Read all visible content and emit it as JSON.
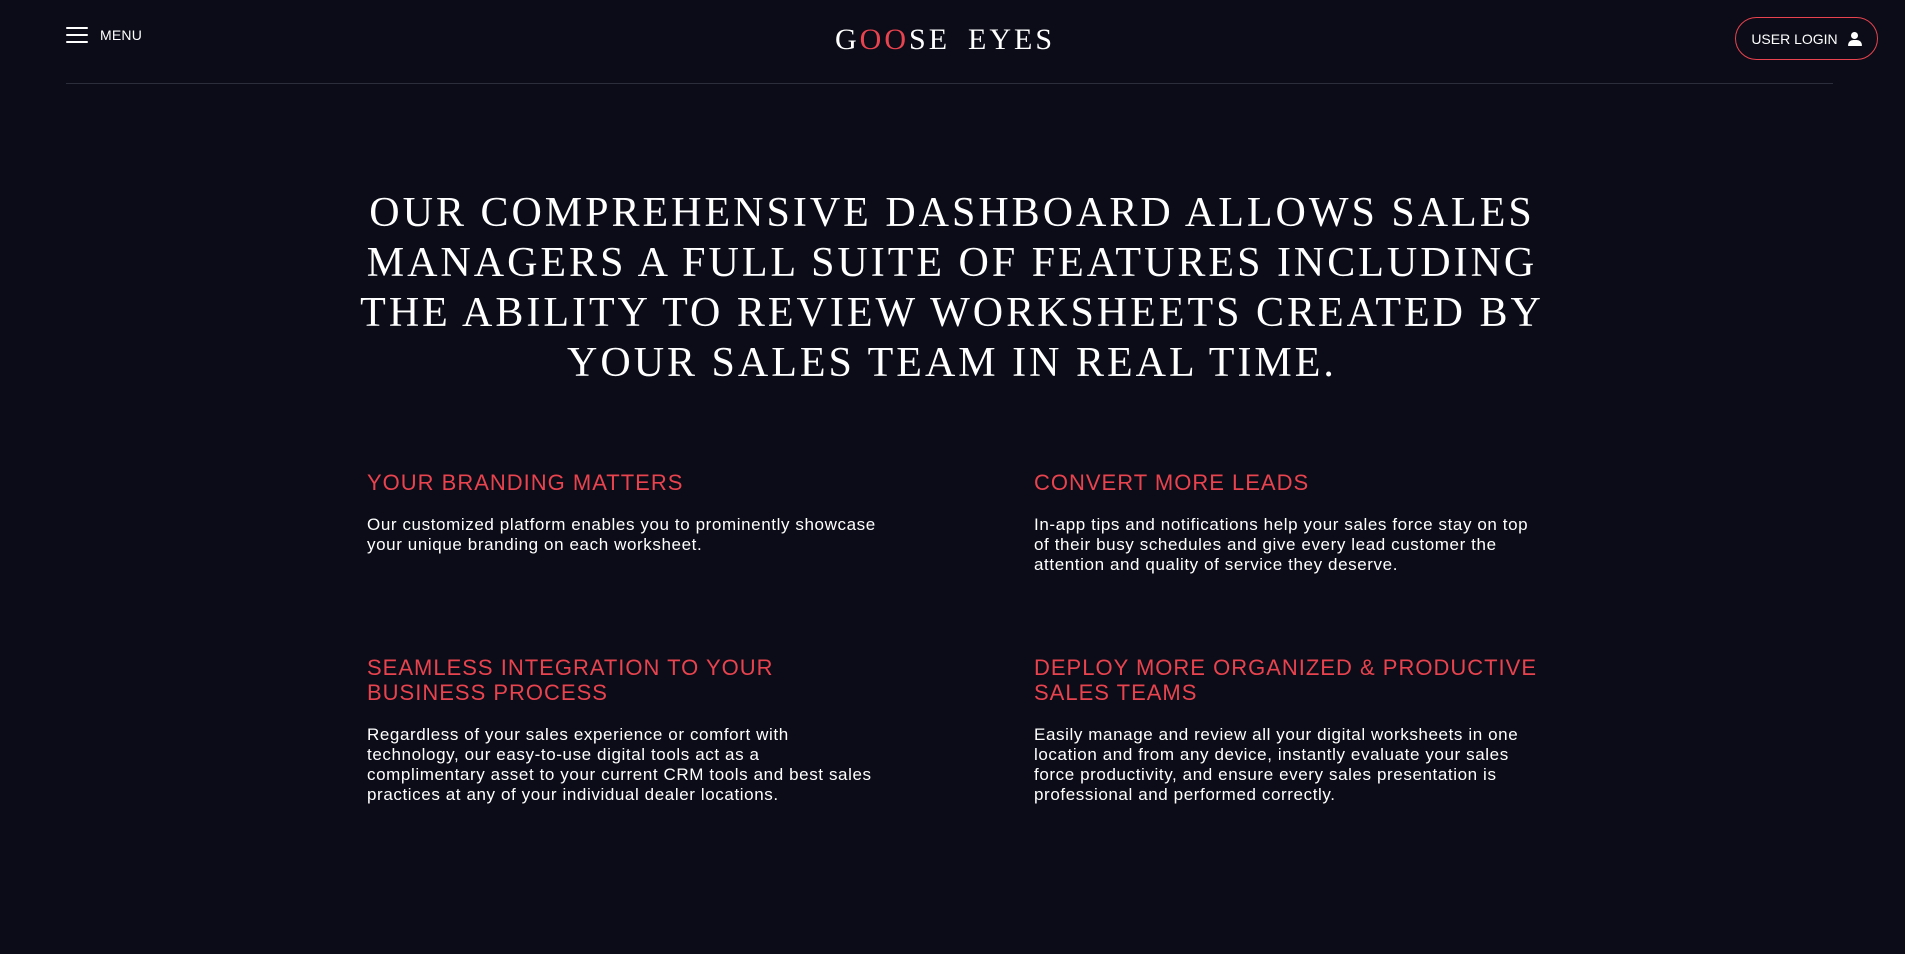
{
  "header": {
    "menu_label": "MENU",
    "logo": {
      "part1_g": "G",
      "part1_oo": "OO",
      "part1_se": "SE",
      "part2": "EYES"
    },
    "login_label": "USER LOGIN"
  },
  "main": {
    "headline": "OUR COMPREHENSIVE DASHBOARD ALLOWS SALES MANAGERS A FULL SUITE OF FEATURES INCLUDING THE ABILITY TO REVIEW WORKSHEETS CREATED BY YOUR SALES TEAM IN REAL TIME.",
    "features": [
      {
        "title": "YOUR BRANDING MATTERS",
        "text": "Our customized platform enables you to prominently showcase your unique branding on each worksheet."
      },
      {
        "title": "CONVERT MORE LEADS",
        "text": "In-app tips and notifications help your sales force stay on top of their busy schedules and give every lead customer the attention and quality of service they deserve."
      },
      {
        "title": "SEAMLESS INTEGRATION TO YOUR BUSINESS PROCESS",
        "text": "Regardless of your sales experience or comfort with technology, our easy-to-use digital tools act as a complimentary asset to your current CRM tools and best sales practices at any of your individual dealer locations."
      },
      {
        "title": "DEPLOY MORE ORGANIZED & PRODUCTIVE SALES TEAMS",
        "text": "Easily manage and review all your digital worksheets in one location and from any device, instantly evaluate your sales force productivity, and ensure every sales presentation is professional and performed correctly."
      }
    ]
  },
  "colors": {
    "background": "#0b0c17",
    "accent": "#e8434e",
    "text": "#ffffff"
  },
  "icons": {
    "menu": "hamburger-icon",
    "login": "person-icon"
  }
}
